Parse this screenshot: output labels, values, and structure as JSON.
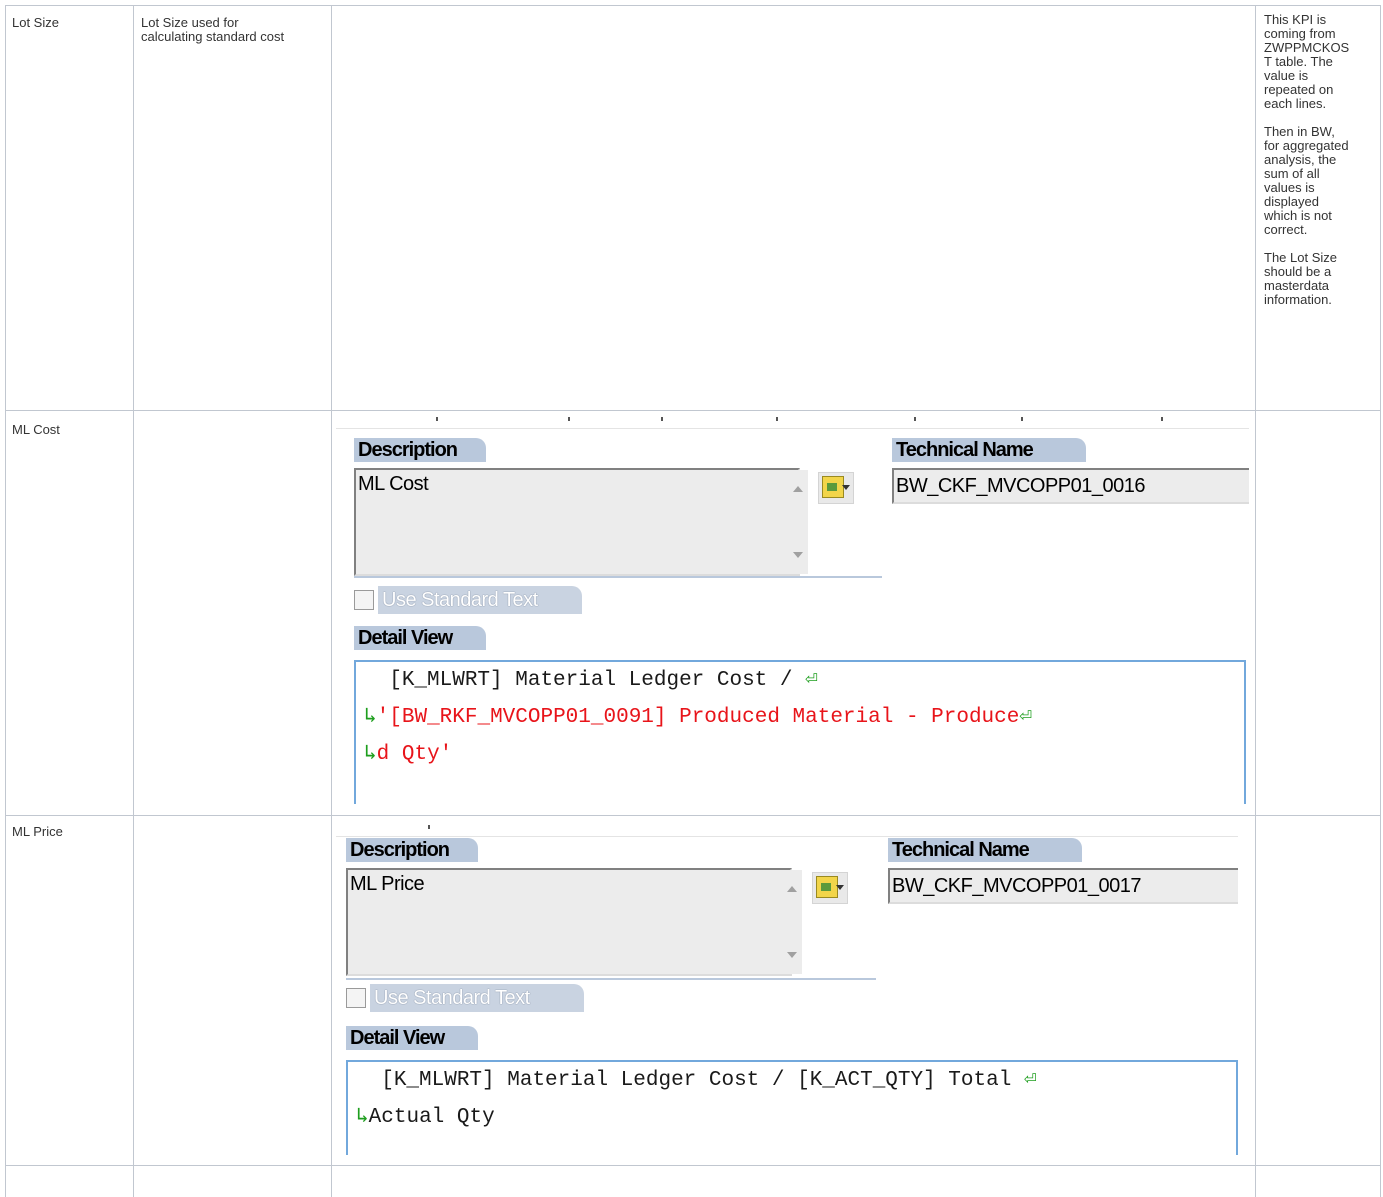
{
  "rows": [
    {
      "name": "Lot Size",
      "definition": "Lot Size used for\ncalculating standard cost",
      "comments": [
        "This KPI is\ncoming from\nZWPPMCKOS\nT table. The\nvalue is\nrepeated on\neach lines.",
        "Then in BW,\nfor aggregated\nanalysis, the\nsum of all\nvalues is\ndisplayed\nwhich is not\ncorrect.",
        "The Lot Size\nshould be a\nmasterdata\ninformation."
      ]
    },
    {
      "name": "ML Cost",
      "definition": "",
      "panel": {
        "description_label": "Description",
        "description_value": "ML Cost",
        "technical_label": "Technical Name",
        "technical_value": "BW_CKF_MVCOPP01_0016",
        "use_standard_text": "Use Standard Text",
        "detail_label": "Detail View",
        "detail_line1": "[K_MLWRT] Material Ledger Cost / ",
        "detail_line2": "'[BW_RKF_MVCOPP01_0091] Produced Material - Produce",
        "detail_line3": "d Qty'"
      }
    },
    {
      "name": "ML Price",
      "definition": "",
      "panel": {
        "description_label": "Description",
        "description_value": "ML Price",
        "technical_label": "Technical Name",
        "technical_value": "BW_CKF_MVCOPP01_0017",
        "use_standard_text": "Use Standard Text",
        "detail_label": "Detail View",
        "detail_line1": "[K_MLWRT] Material Ledger Cost / [K_ACT_QTY] Total ",
        "detail_line2": "Actual Qty"
      }
    }
  ],
  "glyphs": {
    "wrap": "⏎",
    "cont": "↳"
  },
  "colors": {
    "border": "#c1c7d0",
    "group_tab": "#b9c8dc",
    "detail_border": "#72a8dc",
    "red": "#e8141a",
    "green": "#1e9e1e"
  }
}
